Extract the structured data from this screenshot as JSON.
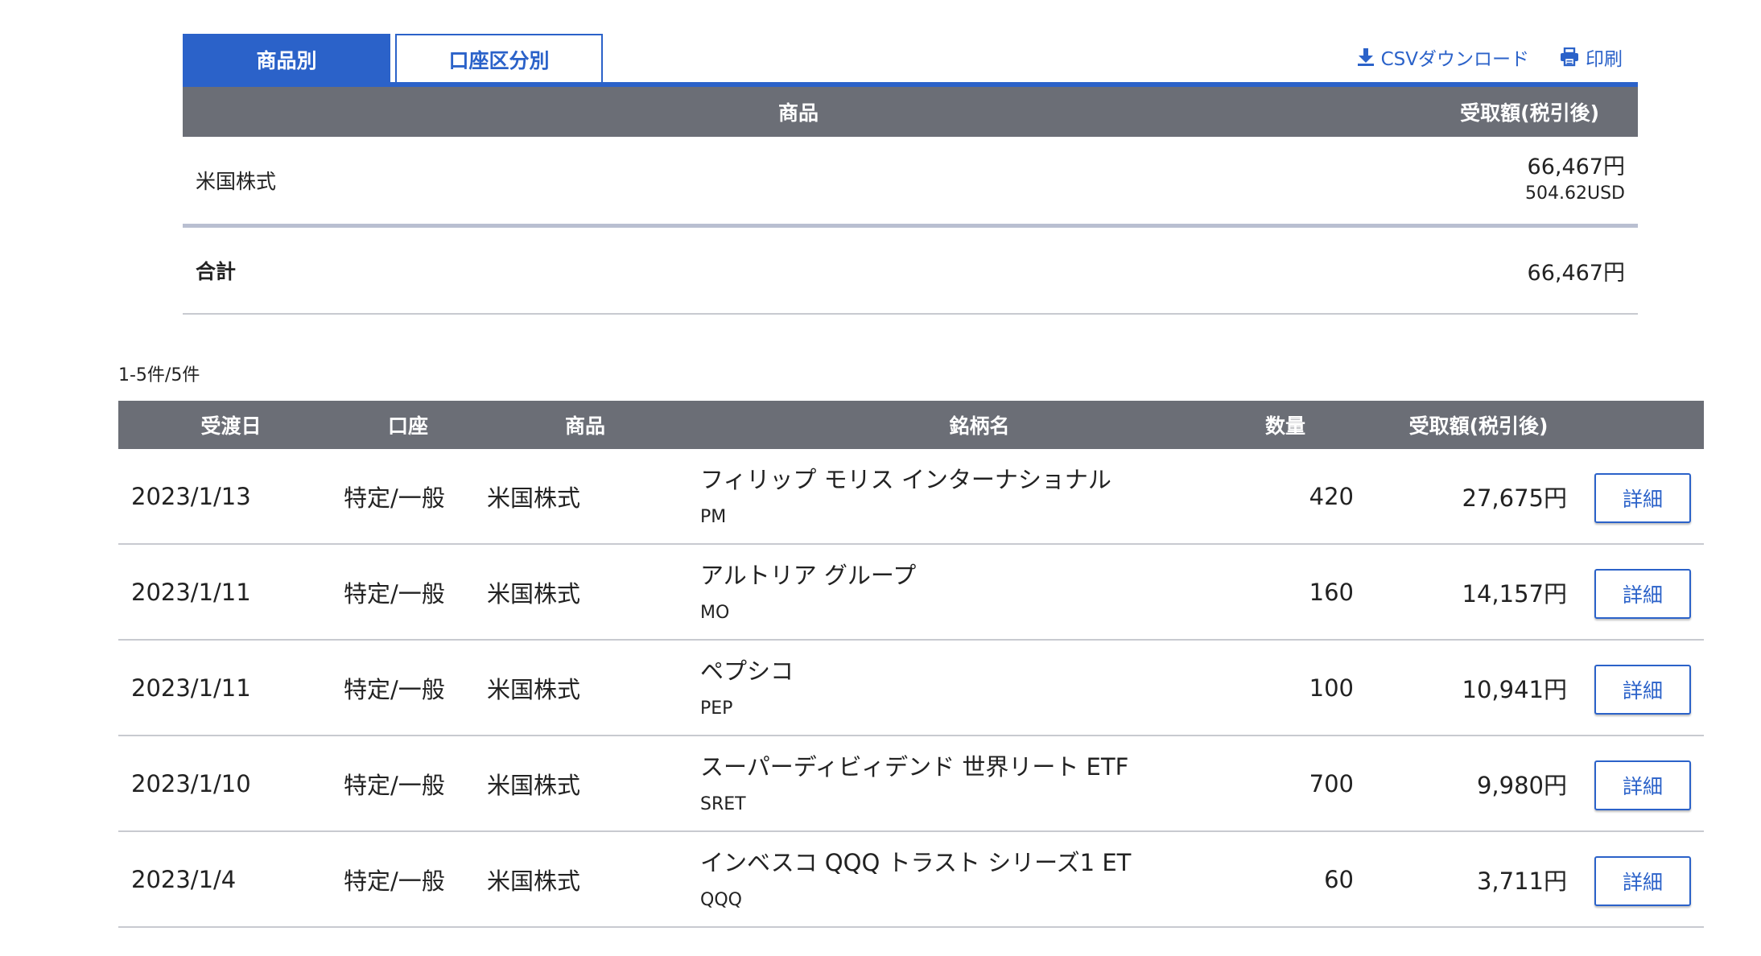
{
  "tabs": {
    "by_product": "商品別",
    "by_account": "口座区分別"
  },
  "actions": {
    "csv": "CSVダウンロード",
    "print": "印刷"
  },
  "summary": {
    "headers": {
      "product": "商品",
      "amount": "受取額(税引後)"
    },
    "rows": [
      {
        "label": "米国株式",
        "amount_jpy": "66,467円",
        "amount_usd": "504.62USD"
      }
    ],
    "total": {
      "label": "合計",
      "amount": "66,467円"
    }
  },
  "count_text": "1-5件/5件",
  "detail": {
    "headers": {
      "date": "受渡日",
      "account": "口座",
      "product": "商品",
      "name": "銘柄名",
      "quantity": "数量",
      "amount": "受取額(税引後)"
    },
    "detail_button": "詳細",
    "rows": [
      {
        "date": "2023/1/13",
        "account": "特定/一般",
        "product": "米国株式",
        "name": "フィリップ モリス インターナショナル",
        "ticker": "PM",
        "quantity": "420",
        "amount": "27,675円"
      },
      {
        "date": "2023/1/11",
        "account": "特定/一般",
        "product": "米国株式",
        "name": "アルトリア グループ",
        "ticker": "MO",
        "quantity": "160",
        "amount": "14,157円"
      },
      {
        "date": "2023/1/11",
        "account": "特定/一般",
        "product": "米国株式",
        "name": "ペプシコ",
        "ticker": "PEP",
        "quantity": "100",
        "amount": "10,941円"
      },
      {
        "date": "2023/1/10",
        "account": "特定/一般",
        "product": "米国株式",
        "name": "スーパーディビィデンド 世界リート ETF",
        "ticker": "SRET",
        "quantity": "700",
        "amount": "9,980円"
      },
      {
        "date": "2023/1/4",
        "account": "特定/一般",
        "product": "米国株式",
        "name": "インベスコ QQQ トラスト シリーズ1 ET",
        "ticker": "QQQ",
        "quantity": "60",
        "amount": "3,711円"
      }
    ]
  },
  "colors": {
    "accent": "#2b62c9",
    "header_bg": "#6b6e76",
    "divider": "#c8cad0",
    "summary_divider": "#b9bfd1"
  },
  "icons": {
    "csv": "download-icon",
    "print": "printer-icon"
  }
}
